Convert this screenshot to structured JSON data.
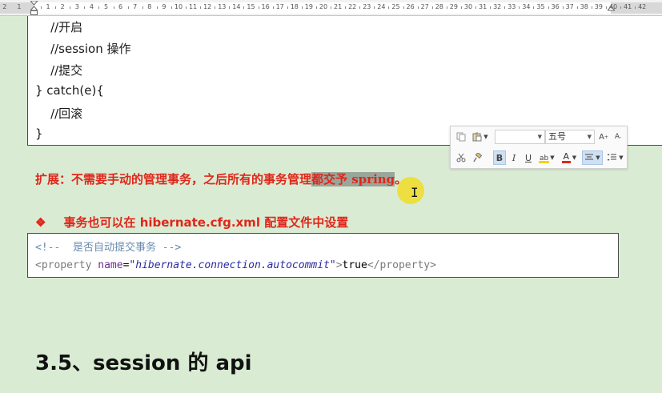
{
  "ruler": {
    "left_labels": [
      "2",
      "1"
    ],
    "labels": [
      "1",
      "2",
      "3",
      "4",
      "5",
      "6",
      "7",
      "8",
      "9",
      "10",
      "11",
      "12",
      "13",
      "14",
      "15",
      "16",
      "17",
      "18",
      "19",
      "20",
      "21",
      "22",
      "23",
      "24",
      "25",
      "26",
      "27",
      "28",
      "29",
      "30",
      "31",
      "32",
      "33",
      "34",
      "35",
      "36",
      "37",
      "38",
      "39",
      "40",
      "41",
      "42"
    ]
  },
  "code_top": {
    "lines": [
      "    //开启",
      "    //session 操作",
      "    //提交",
      "} catch(e){",
      "    //回滚",
      "}"
    ]
  },
  "note": {
    "prefix": "扩展：不需要手动的管理事务，之后所有的事务管理",
    "highlighted": "都交予 spring",
    "suffix": "。"
  },
  "bullet": {
    "symbol": "❖",
    "text_before": "事务也可以在 ",
    "file": "hibernate.cfg.xml",
    "text_after": " 配置文件中设置"
  },
  "xml": {
    "comment": "<!--  是否自动提交事务 -->",
    "open_tag": "<property ",
    "attr_name": "name",
    "eq": "=",
    "attr_value": "\"hibernate.connection.autocommit\"",
    "close_open": ">",
    "text": "true",
    "close_tag": "</property>"
  },
  "heading": {
    "text": "3.5、session 的 api"
  },
  "toolbar": {
    "font_name_value": "",
    "font_size_value": "五号",
    "grow_label": "A",
    "shrink_label": "A",
    "bold_label": "B",
    "italic_label": "I",
    "underline_label": "U",
    "font_color_label": "A",
    "highlight_color": "#f5d300",
    "font_color": "#e0261a"
  },
  "colors": {
    "page_bg": "#d9ecd3",
    "note_red": "#e0261a",
    "selection": "#9aa69a"
  }
}
